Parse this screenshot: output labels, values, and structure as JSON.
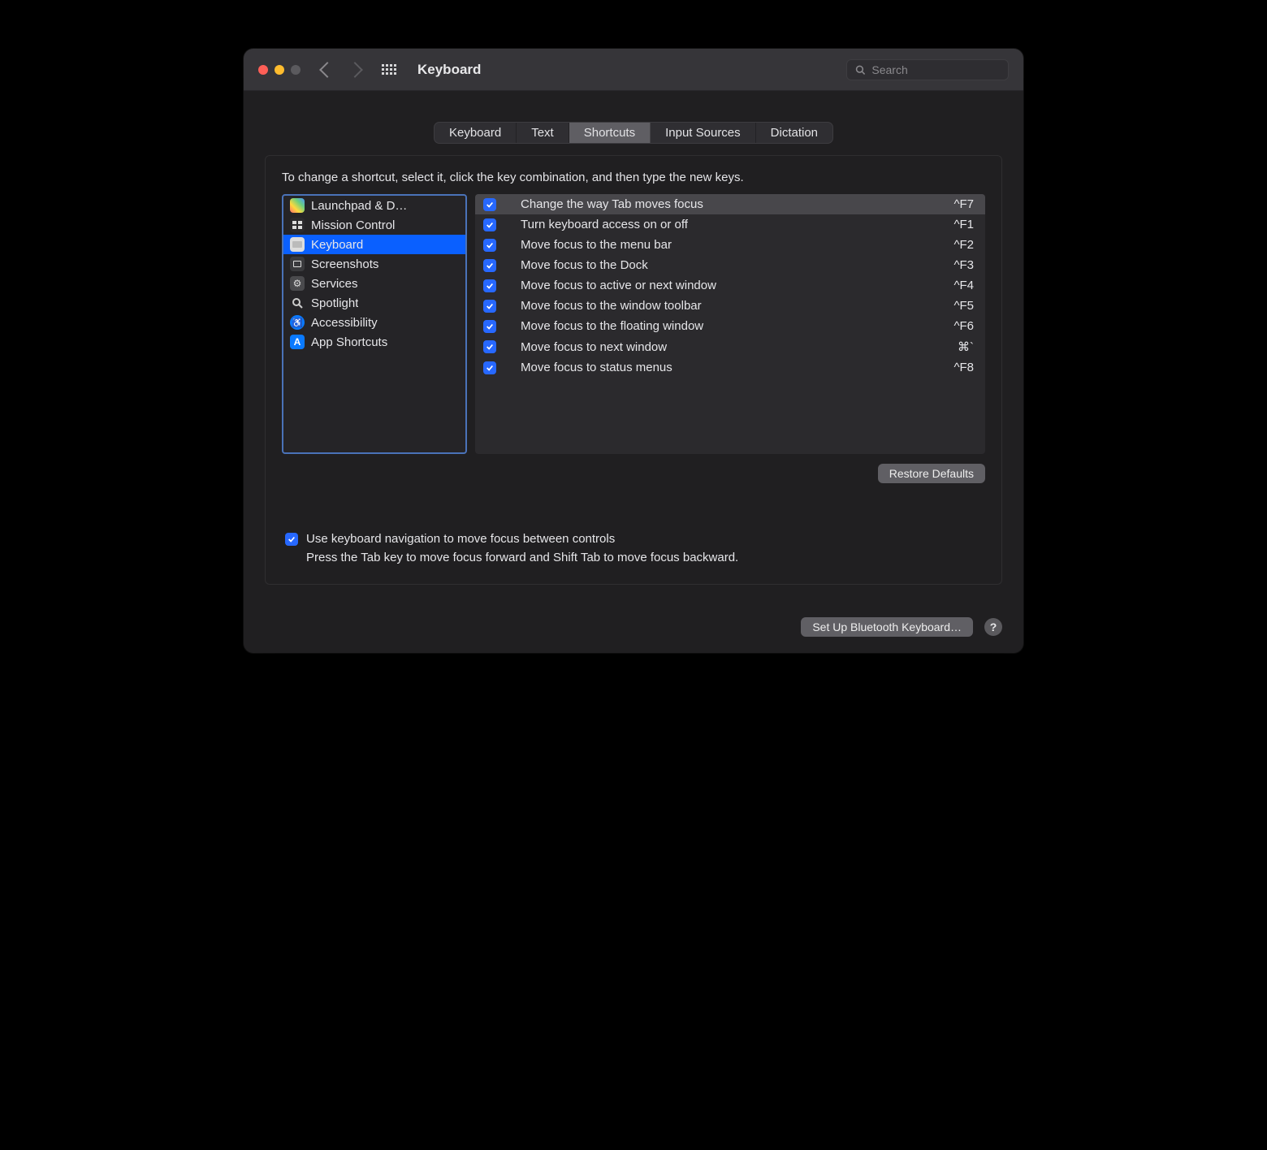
{
  "window": {
    "title": "Keyboard",
    "search_placeholder": "Search"
  },
  "tabs": [
    {
      "label": "Keyboard",
      "active": false
    },
    {
      "label": "Text",
      "active": false
    },
    {
      "label": "Shortcuts",
      "active": true
    },
    {
      "label": "Input Sources",
      "active": false
    },
    {
      "label": "Dictation",
      "active": false
    }
  ],
  "instruction": "To change a shortcut, select it, click the key combination, and then type the new keys.",
  "categories": [
    {
      "label": "Launchpad & D…",
      "icon": "launchpad",
      "selected": false
    },
    {
      "label": "Mission Control",
      "icon": "mission-control",
      "selected": false
    },
    {
      "label": "Keyboard",
      "icon": "keyboard",
      "selected": true
    },
    {
      "label": "Screenshots",
      "icon": "screenshots",
      "selected": false
    },
    {
      "label": "Services",
      "icon": "services",
      "selected": false
    },
    {
      "label": "Spotlight",
      "icon": "spotlight",
      "selected": false
    },
    {
      "label": "Accessibility",
      "icon": "accessibility",
      "selected": false
    },
    {
      "label": "App Shortcuts",
      "icon": "app-shortcuts",
      "selected": false
    }
  ],
  "shortcuts": [
    {
      "checked": true,
      "label": "Change the way Tab moves focus",
      "key": "^F7",
      "selected": true
    },
    {
      "checked": true,
      "label": "Turn keyboard access on or off",
      "key": "^F1",
      "selected": false
    },
    {
      "checked": true,
      "label": "Move focus to the menu bar",
      "key": "^F2",
      "selected": false
    },
    {
      "checked": true,
      "label": "Move focus to the Dock",
      "key": "^F3",
      "selected": false
    },
    {
      "checked": true,
      "label": "Move focus to active or next window",
      "key": "^F4",
      "selected": false
    },
    {
      "checked": true,
      "label": "Move focus to the window toolbar",
      "key": "^F5",
      "selected": false
    },
    {
      "checked": true,
      "label": "Move focus to the floating window",
      "key": "^F6",
      "selected": false
    },
    {
      "checked": true,
      "label": "Move focus to next window",
      "key": "⌘`",
      "selected": false
    },
    {
      "checked": true,
      "label": "Move focus to status menus",
      "key": "^F8",
      "selected": false
    }
  ],
  "restore_button": "Restore Defaults",
  "kb_nav": {
    "checked": true,
    "label": "Use keyboard navigation to move focus between controls",
    "sub": "Press the Tab key to move focus forward and Shift Tab to move focus backward."
  },
  "footer": {
    "bluetooth_button": "Set Up Bluetooth Keyboard…",
    "help": "?"
  }
}
